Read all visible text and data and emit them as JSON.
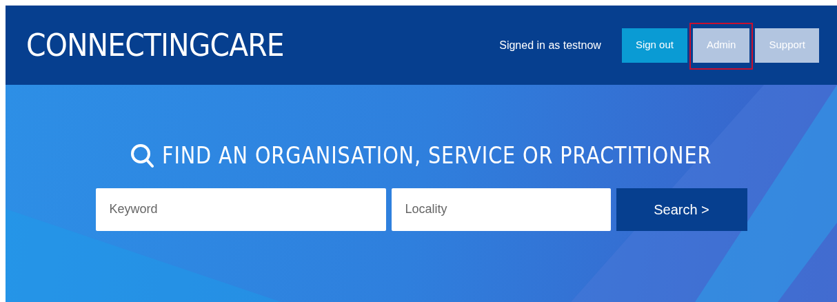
{
  "header": {
    "logo": "CONNECTINGCARE",
    "signed_in": "Signed in as testnow",
    "buttons": [
      {
        "label": "Sign out",
        "kind": "primary",
        "highlighted": false
      },
      {
        "label": "Admin",
        "kind": "secondary",
        "highlighted": true
      },
      {
        "label": "Support",
        "kind": "secondary",
        "highlighted": false
      }
    ]
  },
  "search": {
    "title": "FIND AN ORGANISATION, SERVICE OR PRACTITIONER",
    "keyword": {
      "placeholder": "Keyword"
    },
    "locality": {
      "placeholder": "Locality"
    },
    "button": "Search >"
  }
}
